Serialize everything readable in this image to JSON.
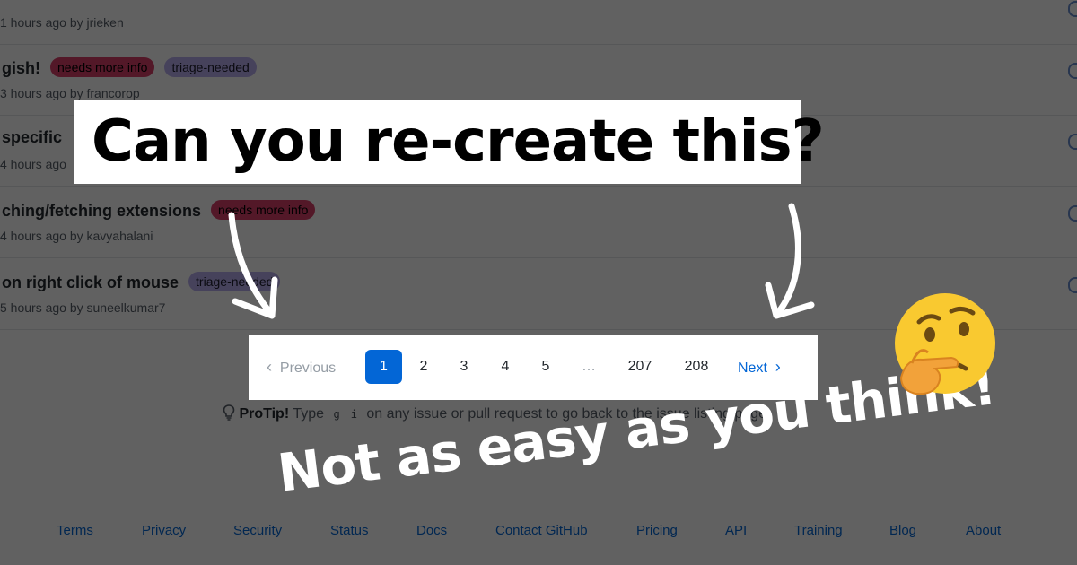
{
  "issues": [
    {
      "title": "",
      "labels": [],
      "meta": "1 hours ago by jrieken"
    },
    {
      "title": "gish!",
      "labels": [
        {
          "text": "needs more info",
          "kind": "red"
        },
        {
          "text": "triage-needed",
          "kind": "purple"
        }
      ],
      "meta": "3 hours ago by francorop"
    },
    {
      "title": "specific",
      "labels": [],
      "meta": "4 hours ago"
    },
    {
      "title": "ching/fetching extensions",
      "labels": [
        {
          "text": "needs more info",
          "kind": "red"
        }
      ],
      "meta": "4 hours ago by kavyahalani"
    },
    {
      "title": "on right click of mouse",
      "labels": [
        {
          "text": "triage-needed",
          "kind": "purple"
        }
      ],
      "meta": "5 hours ago by suneelkumar7"
    }
  ],
  "pagination": {
    "previous": "Previous",
    "next": "Next",
    "current": "1",
    "pages": [
      "2",
      "3",
      "4",
      "5"
    ],
    "ellipsis": "…",
    "tail_pages": [
      "207",
      "208"
    ]
  },
  "protip": {
    "label": "ProTip!",
    "before": "Type",
    "keys": [
      "g",
      "i"
    ],
    "after": "on any issue or pull request to go back to the issue listing page."
  },
  "footer": [
    "Terms",
    "Privacy",
    "Security",
    "Status",
    "Docs",
    "Contact GitHub",
    "Pricing",
    "API",
    "Training",
    "Blog",
    "About"
  ],
  "overlay": {
    "headline": "Can you re-create this?",
    "tagline": "Not as easy as you think!",
    "emoji": "thinking-face-icon"
  },
  "colors": {
    "accent": "#0366d6",
    "label_red": "#d93f6b",
    "label_purple": "#b9aef0"
  }
}
